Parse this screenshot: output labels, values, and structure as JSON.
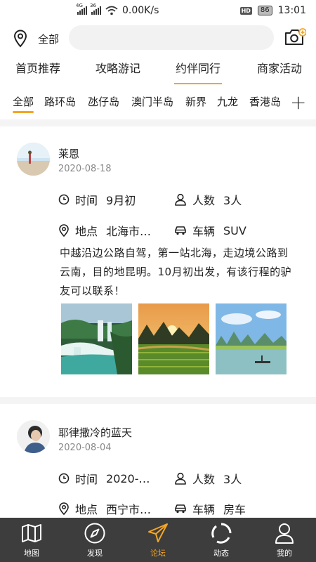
{
  "status_bar": {
    "signal_labels": [
      "4G",
      "36"
    ],
    "net_speed": "0.00K/s",
    "hd": "HD",
    "battery": "86",
    "time": "13:01"
  },
  "header": {
    "location_label": "全部",
    "search_placeholder": ""
  },
  "main_tabs": [
    {
      "label": "首页推荐",
      "active": false
    },
    {
      "label": "攻略游记",
      "active": false
    },
    {
      "label": "约伴同行",
      "active": true
    },
    {
      "label": "商家活动",
      "active": false
    }
  ],
  "region_tabs": [
    {
      "label": "全部",
      "selected": true
    },
    {
      "label": "路环岛"
    },
    {
      "label": "氹仔岛"
    },
    {
      "label": "澳门半岛"
    },
    {
      "label": "新界"
    },
    {
      "label": "九龙"
    },
    {
      "label": "香港岛"
    }
  ],
  "posts": [
    {
      "username": "莱恩",
      "date": "2020-08-18",
      "time_label": "时间",
      "time_value": "9月初",
      "people_label": "人数",
      "people_value": "3人",
      "place_label": "地点",
      "place_value": "北海市…",
      "vehicle_label": "车辆",
      "vehicle_value": "SUV",
      "text": "中越沿边公路自驾，第一站北海，走边境公路到云南，目的地昆明。10月初出发，有该行程的驴友可以联系！",
      "photos": [
        "waterfall",
        "sunset-fields",
        "river-karst"
      ]
    },
    {
      "username": "耶律撒冷的蓝天",
      "date": "2020-08-04",
      "time_label": "时间",
      "time_value": "2020-…",
      "people_label": "人数",
      "people_value": "3人",
      "place_label": "地点",
      "place_value": "西宁市…",
      "vehicle_label": "车辆",
      "vehicle_value": "房车"
    }
  ],
  "bottom_nav": [
    {
      "label": "地图",
      "icon": "map-icon"
    },
    {
      "label": "发现",
      "icon": "compass-icon"
    },
    {
      "label": "论坛",
      "icon": "paper-plane-icon",
      "active": true
    },
    {
      "label": "动态",
      "icon": "refresh-ring-icon"
    },
    {
      "label": "我的",
      "icon": "person-icon"
    }
  ],
  "colors": {
    "accent": "#f5a623",
    "nav_bg": "#3d3d3d"
  }
}
